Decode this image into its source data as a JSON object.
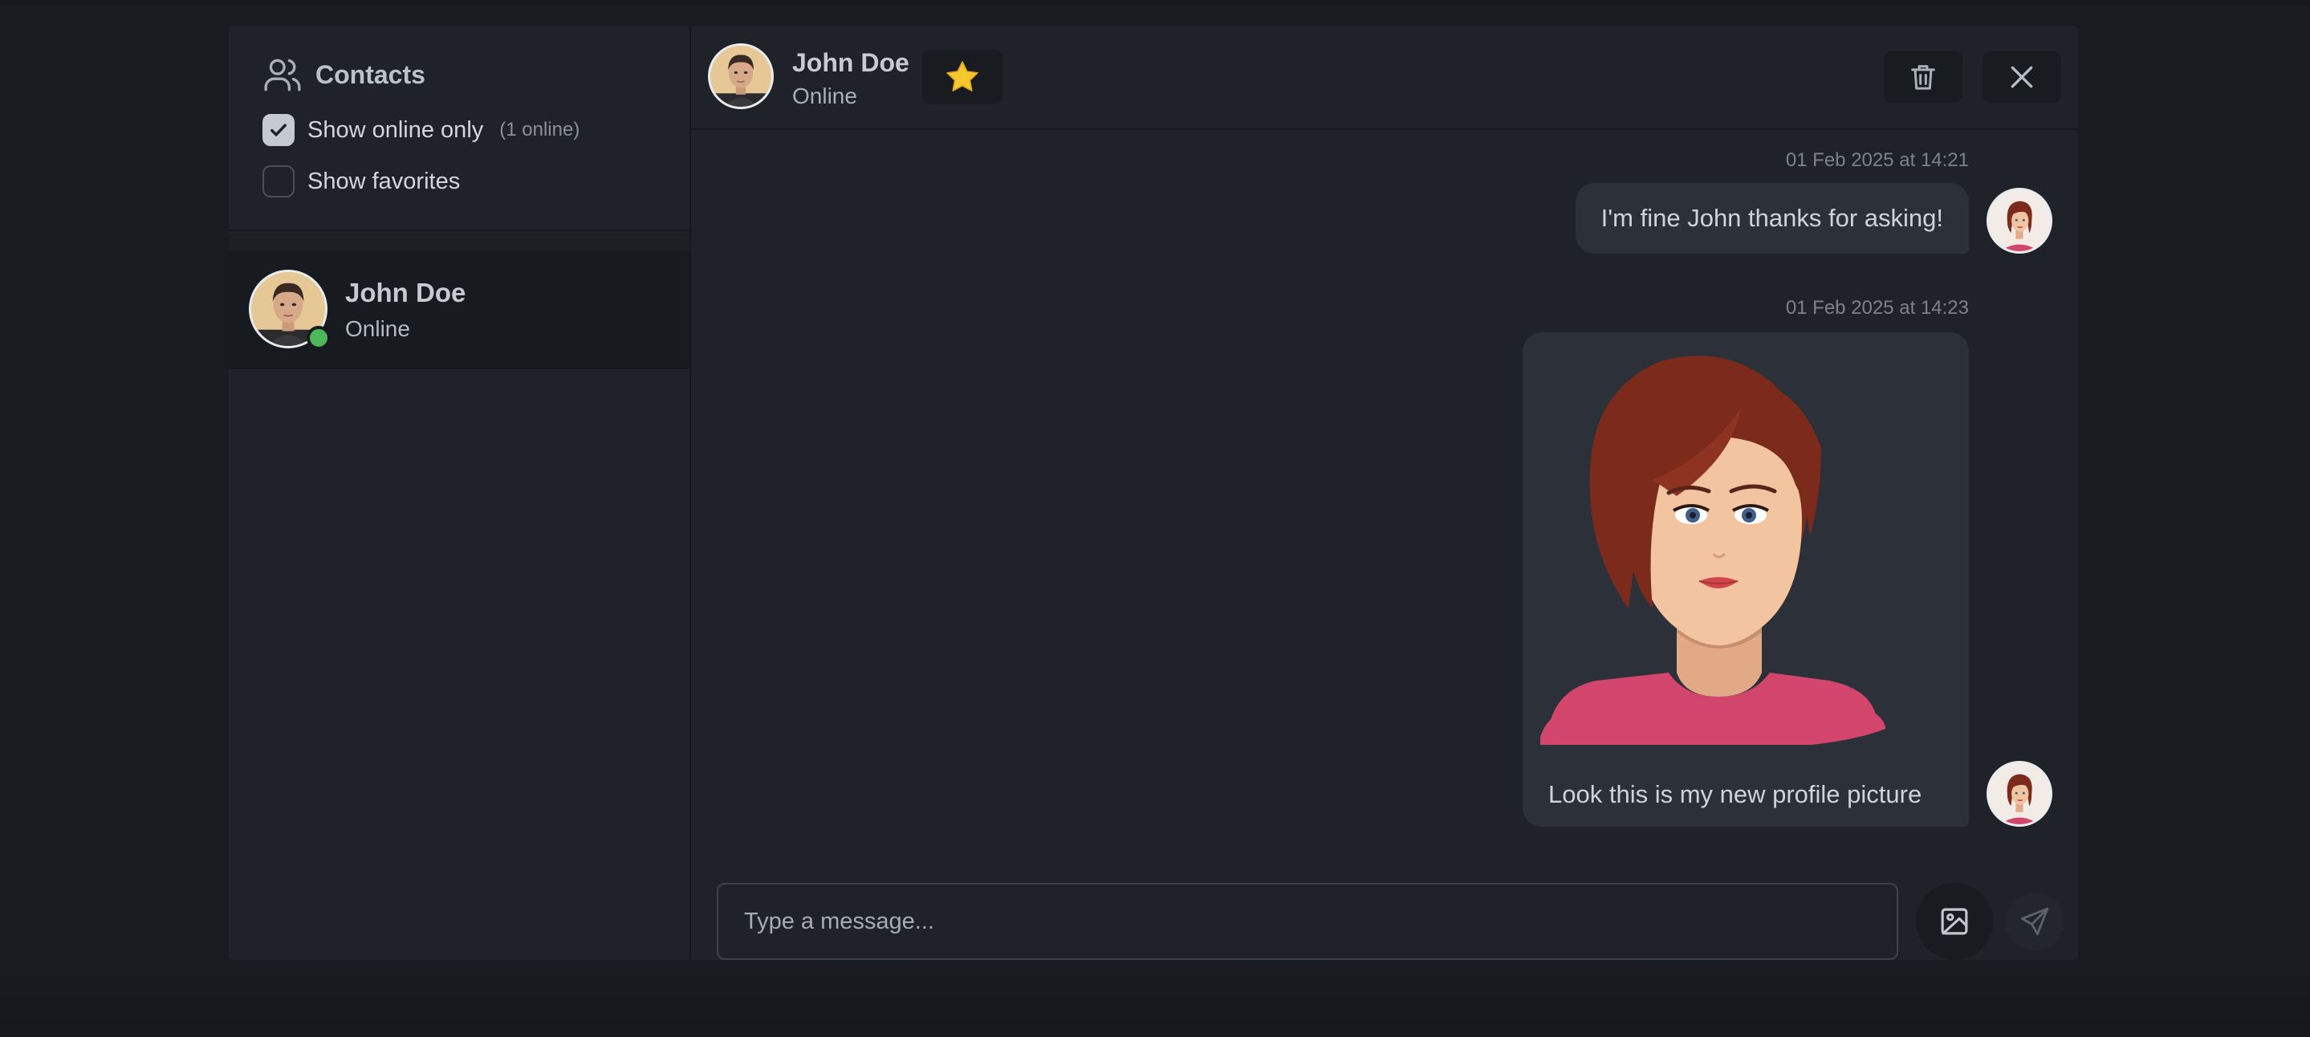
{
  "sidebar": {
    "title": "Contacts",
    "filters": [
      {
        "label": "Show online only",
        "count": "(1 online)",
        "checked": true
      },
      {
        "label": "Show favorites",
        "count": "",
        "checked": false
      }
    ],
    "contacts": [
      {
        "name": "John Doe",
        "status": "Online"
      }
    ]
  },
  "chat": {
    "header": {
      "name": "John Doe",
      "status": "Online"
    },
    "messages": [
      {
        "timestamp": "01 Feb 2025 at 14:21",
        "text": "I'm fine John thanks for asking!"
      },
      {
        "timestamp": "01 Feb 2025 at 14:23",
        "text": "Look this is my new profile picture"
      }
    ],
    "composer": {
      "placeholder": "Type a message..."
    }
  },
  "icons": {
    "contacts": "users-icon",
    "favorite": "star-icon",
    "delete": "trash-icon",
    "close": "close-icon",
    "image": "image-icon",
    "send": "send-icon"
  },
  "colors": {
    "online": "#4db85b",
    "star": "#f6c830",
    "bubble": "#2c3139"
  }
}
